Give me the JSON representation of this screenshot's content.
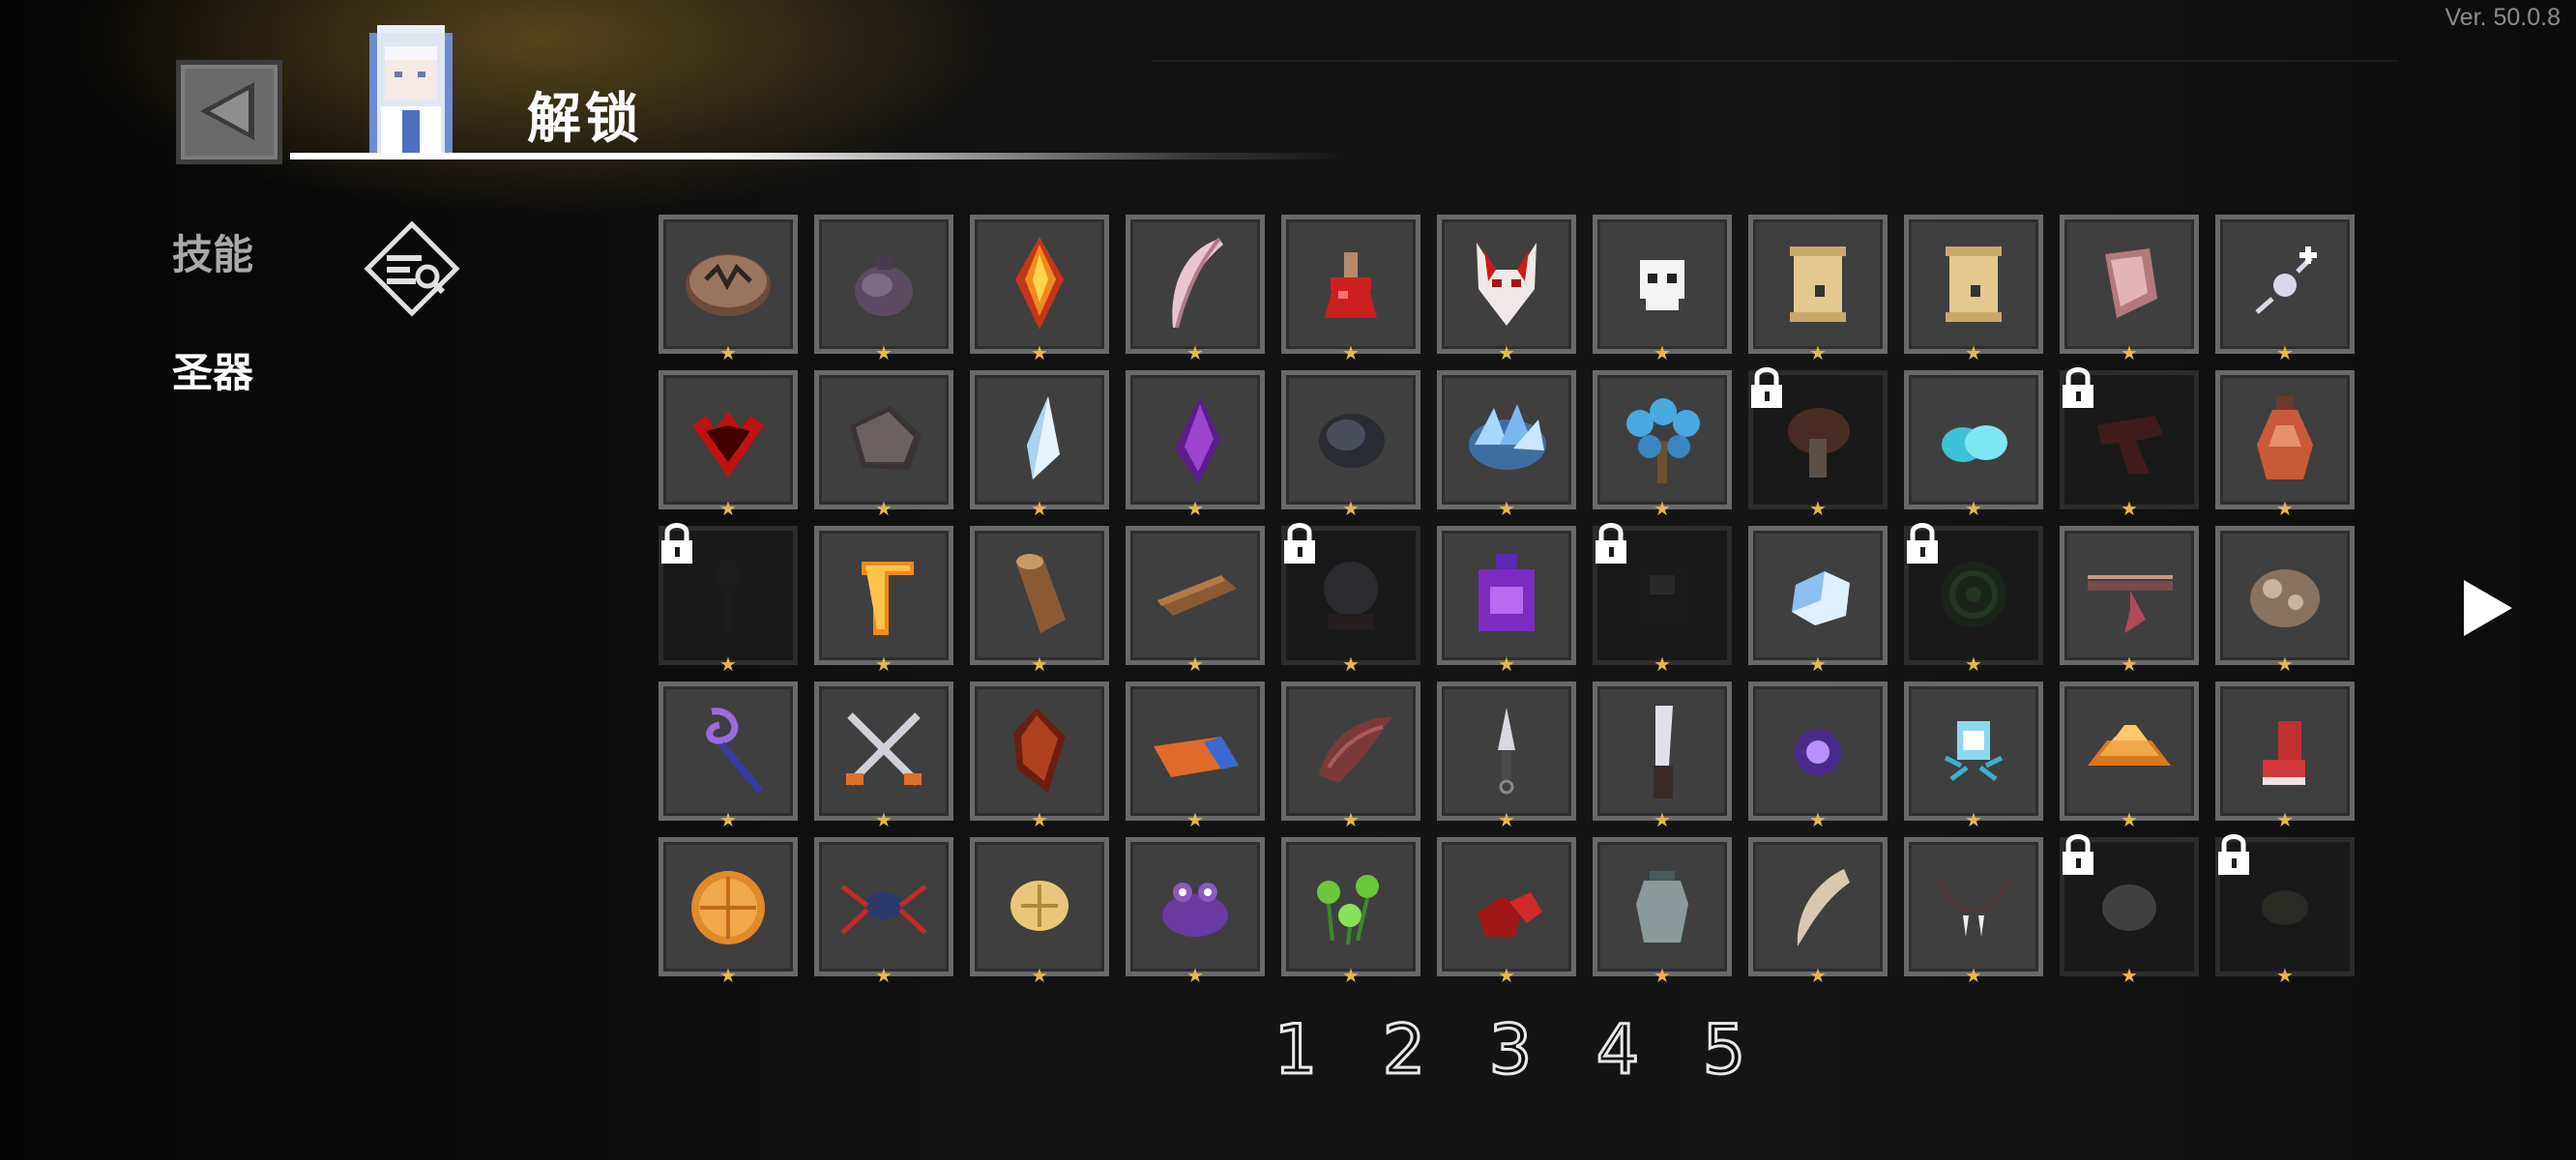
{
  "version": "Ver. 50.0.8",
  "header": {
    "title": "解锁"
  },
  "sidebar": {
    "tabs": [
      {
        "label": "技能",
        "active": false
      },
      {
        "label": "圣器",
        "active": true
      }
    ]
  },
  "colors": {
    "accent": "#ffffff",
    "star": "#e6b84a",
    "slot_bg": "#3f3f3f",
    "slot_border": "#696969",
    "locked_bg": "#191919"
  },
  "grid": {
    "rows": [
      [
        {
          "icon": "rune-stone-icon",
          "locked": false
        },
        {
          "icon": "pouch-icon",
          "locked": false
        },
        {
          "icon": "fire-crystal-icon",
          "locked": false
        },
        {
          "icon": "feather-icon",
          "locked": false
        },
        {
          "icon": "red-potion-icon",
          "locked": false
        },
        {
          "icon": "demon-mask-icon",
          "locked": false
        },
        {
          "icon": "skull-icon",
          "locked": false
        },
        {
          "icon": "scroll-icon",
          "locked": false
        },
        {
          "icon": "scroll-icon",
          "locked": false
        },
        {
          "icon": "meat-icon",
          "locked": false
        },
        {
          "icon": "sparkle-orb-icon",
          "locked": false
        }
      ],
      [
        {
          "icon": "demon-crest-icon",
          "locked": false
        },
        {
          "icon": "iron-ore-icon",
          "locked": false
        },
        {
          "icon": "ice-shard-icon",
          "locked": false
        },
        {
          "icon": "amethyst-icon",
          "locked": false
        },
        {
          "icon": "coal-icon",
          "locked": false
        },
        {
          "icon": "blue-crystal-icon",
          "locked": false
        },
        {
          "icon": "crystal-tree-icon",
          "locked": false
        },
        {
          "icon": "mushroom-icon",
          "locked": true
        },
        {
          "icon": "blue-orbs-icon",
          "locked": false
        },
        {
          "icon": "red-scarf-icon",
          "locked": true
        },
        {
          "icon": "vase-icon",
          "locked": false
        }
      ],
      [
        {
          "icon": "spoon-icon",
          "locked": true
        },
        {
          "icon": "boomerang-icon",
          "locked": false
        },
        {
          "icon": "wood-log-icon",
          "locked": false
        },
        {
          "icon": "wood-plank-icon",
          "locked": false
        },
        {
          "icon": "snow-globe-icon",
          "locked": true
        },
        {
          "icon": "purple-bottle-icon",
          "locked": false
        },
        {
          "icon": "dark-book-icon",
          "locked": true
        },
        {
          "icon": "ice-cube-icon",
          "locked": false
        },
        {
          "icon": "green-vortex-icon",
          "locked": true
        },
        {
          "icon": "crossbow-icon",
          "locked": false
        },
        {
          "icon": "rock-pile-icon",
          "locked": false
        }
      ],
      [
        {
          "icon": "purple-staff-icon",
          "locked": false
        },
        {
          "icon": "crossed-swords-icon",
          "locked": false
        },
        {
          "icon": "red-gem-icon",
          "locked": false
        },
        {
          "icon": "flag-book-icon",
          "locked": false
        },
        {
          "icon": "wing-icon",
          "locked": false
        },
        {
          "icon": "kunai-icon",
          "locked": false
        },
        {
          "icon": "knife-icon",
          "locked": false
        },
        {
          "icon": "purple-orb-icon",
          "locked": false
        },
        {
          "icon": "spirit-lamp-icon",
          "locked": false
        },
        {
          "icon": "gold-bars-icon",
          "locked": false
        },
        {
          "icon": "red-boot-icon",
          "locked": false
        }
      ],
      [
        {
          "icon": "orange-ball-icon",
          "locked": false
        },
        {
          "icon": "spider-icon",
          "locked": false
        },
        {
          "icon": "shell-icon",
          "locked": false
        },
        {
          "icon": "frog-icon",
          "locked": false
        },
        {
          "icon": "green-sprouts-icon",
          "locked": false
        },
        {
          "icon": "red-ore-icon",
          "locked": false
        },
        {
          "icon": "jar-icon",
          "locked": false
        },
        {
          "icon": "fang-icon",
          "locked": false
        },
        {
          "icon": "tooth-necklace-icon",
          "locked": false
        },
        {
          "icon": "grey-stone-icon",
          "locked": true
        },
        {
          "icon": "dark-stone-icon",
          "locked": true
        }
      ]
    ]
  },
  "pager": {
    "pages": [
      "1",
      "2",
      "3",
      "4",
      "5"
    ]
  }
}
